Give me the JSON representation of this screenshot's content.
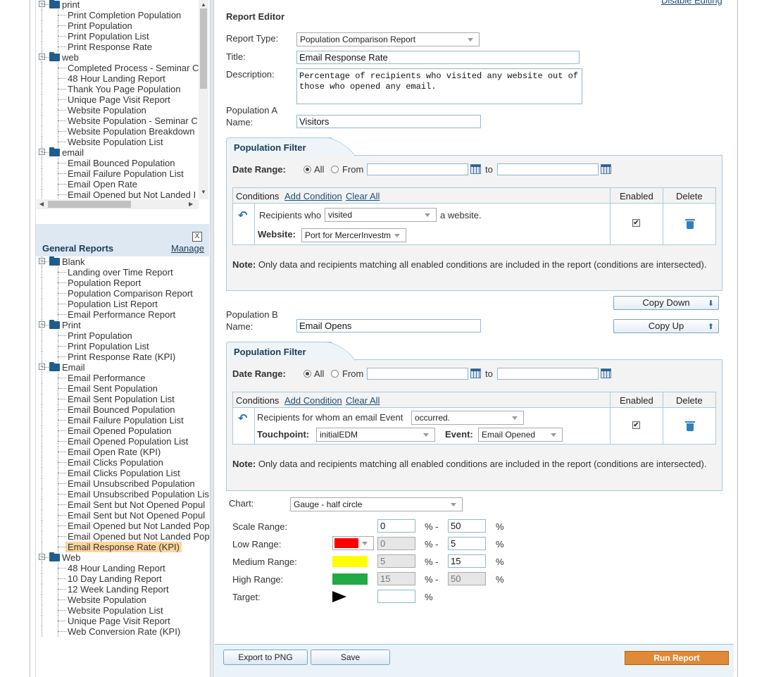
{
  "top_link": "Disable Editing",
  "tree1": [
    {
      "type": "folder",
      "label": "print"
    },
    {
      "type": "leaf",
      "label": "Print Completion Population"
    },
    {
      "type": "leaf",
      "label": "Print Population"
    },
    {
      "type": "leaf",
      "label": "Print Population List"
    },
    {
      "type": "leaf",
      "label": "Print Response Rate"
    },
    {
      "type": "folder",
      "label": "web"
    },
    {
      "type": "leaf",
      "label": "Completed Process - Seminar C"
    },
    {
      "type": "leaf",
      "label": "48 Hour Landing Report"
    },
    {
      "type": "leaf",
      "label": "Thank You Page Population"
    },
    {
      "type": "leaf",
      "label": "Unique Page Visit Report"
    },
    {
      "type": "leaf",
      "label": "Website Population"
    },
    {
      "type": "leaf",
      "label": "Website Population - Seminar C"
    },
    {
      "type": "leaf",
      "label": "Website Population Breakdown"
    },
    {
      "type": "leaf",
      "label": "Website Population List"
    },
    {
      "type": "folder",
      "label": "email"
    },
    {
      "type": "leaf",
      "label": "Email Bounced Population"
    },
    {
      "type": "leaf",
      "label": "Email Failure Population List"
    },
    {
      "type": "leaf",
      "label": "Email Open Rate"
    },
    {
      "type": "leaf",
      "label": "Email Opened but Not Landed I"
    }
  ],
  "general": {
    "title": "General Reports",
    "manage": "Manage",
    "close": "X"
  },
  "tree2": [
    {
      "type": "folder",
      "label": "Blank"
    },
    {
      "type": "leaf",
      "label": "Landing over Time Report"
    },
    {
      "type": "leaf",
      "label": "Population Report"
    },
    {
      "type": "leaf",
      "label": "Population Comparison Report"
    },
    {
      "type": "leaf",
      "label": "Population List Report"
    },
    {
      "type": "leaf",
      "label": "Email Performance Report"
    },
    {
      "type": "folder",
      "label": "Print"
    },
    {
      "type": "leaf",
      "label": "Print Population"
    },
    {
      "type": "leaf",
      "label": "Print Population List"
    },
    {
      "type": "leaf",
      "label": "Print Response Rate (KPI)"
    },
    {
      "type": "folder",
      "label": "Email"
    },
    {
      "type": "leaf",
      "label": "Email Performance"
    },
    {
      "type": "leaf",
      "label": "Email Sent Population"
    },
    {
      "type": "leaf",
      "label": "Email Sent Population List"
    },
    {
      "type": "leaf",
      "label": "Email Bounced Population"
    },
    {
      "type": "leaf",
      "label": "Email Failure Population List"
    },
    {
      "type": "leaf",
      "label": "Email Opened Population"
    },
    {
      "type": "leaf",
      "label": "Email Opened Population List"
    },
    {
      "type": "leaf",
      "label": "Email Open Rate (KPI)"
    },
    {
      "type": "leaf",
      "label": "Email Clicks Population"
    },
    {
      "type": "leaf",
      "label": "Email Clicks Population List"
    },
    {
      "type": "leaf",
      "label": "Email Unsubscribed Population"
    },
    {
      "type": "leaf",
      "label": "Email Unsubscribed Population Lis"
    },
    {
      "type": "leaf",
      "label": "Email Sent but Not Opened Popul"
    },
    {
      "type": "leaf",
      "label": "Email Sent but Not Opened Popul"
    },
    {
      "type": "leaf",
      "label": "Email Opened but Not Landed Pop"
    },
    {
      "type": "leaf",
      "label": "Email Opened but Not Landed Pop"
    },
    {
      "type": "leaf",
      "label": "Email Response Rate (KPI)",
      "selected": true
    },
    {
      "type": "folder",
      "label": "Web"
    },
    {
      "type": "leaf",
      "label": "48 Hour Landing Report"
    },
    {
      "type": "leaf",
      "label": "10 Day Landing Report"
    },
    {
      "type": "leaf",
      "label": "12 Week Landing Report"
    },
    {
      "type": "leaf",
      "label": "Website Population"
    },
    {
      "type": "leaf",
      "label": "Website Population List"
    },
    {
      "type": "leaf",
      "label": "Unique Page Visit Report"
    },
    {
      "type": "leaf",
      "label": "Web Conversion Rate (KPI)"
    }
  ],
  "editor": {
    "heading": "Report Editor",
    "type_label": "Report Type:",
    "type_value": "Population Comparison Report",
    "title_label": "Title:",
    "title_value": "Email Response Rate",
    "desc_label": "Description:",
    "desc_value": "Percentage of recipients who visited any website out of those who opened any email."
  },
  "popA": {
    "label1": "Population A",
    "label2": "Name:",
    "name": "Visitors",
    "filter_title": "Population Filter",
    "date_label": "Date Range:",
    "all": "All",
    "from": "From",
    "to": "to",
    "conditions": "Conditions",
    "add": "Add Condition",
    "clear": "Clear All",
    "enabled": "Enabled",
    "delete": "Delete",
    "cond_prefix": "Recipients who",
    "cond_select": "visited",
    "cond_suffix": "a website.",
    "website_label": "Website:",
    "website_value": "Port for MercerInvestm",
    "note_bold": "Note:",
    "note": " Only data and recipients matching all enabled conditions are included in the report (conditions are intersected)."
  },
  "copy_down": "Copy Down",
  "copy_up": "Copy Up",
  "popB": {
    "label1": "Population B",
    "label2": "Name:",
    "name": "Email Opens",
    "filter_title": "Population Filter",
    "date_label": "Date Range:",
    "all": "All",
    "from": "From",
    "to": "to",
    "conditions": "Conditions",
    "add": "Add Condition",
    "clear": "Clear All",
    "enabled": "Enabled",
    "delete": "Delete",
    "cond_prefix": "Recipients for whom an email Event",
    "cond_select": "occurred.",
    "touch_label": "Touchpoint:",
    "touch_value": "initialEDM",
    "event_label": "Event:",
    "event_value": "Email Opened",
    "note_bold": "Note:",
    "note": " Only data and recipients matching all enabled conditions are included in the report (conditions are intersected)."
  },
  "chart": {
    "label": "Chart:",
    "value": "Gauge - half circle",
    "scale_label": "Scale Range:",
    "scale_min": "0",
    "scale_max": "50",
    "low_label": "Low Range:",
    "low_min": "0",
    "low_max": "5",
    "med_label": "Medium Range:",
    "med_min": "5",
    "med_max": "15",
    "high_label": "High Range:",
    "high_min": "15",
    "high_max": "50",
    "target_label": "Target:",
    "target_value": "",
    "pct": "%",
    "pct_dash": "% -",
    "colors": {
      "low": "#ff0000",
      "medium": "#ffff00",
      "high": "#22aa44"
    }
  },
  "footer": {
    "export": "Export to PNG",
    "save": "Save",
    "run": "Run Report"
  }
}
